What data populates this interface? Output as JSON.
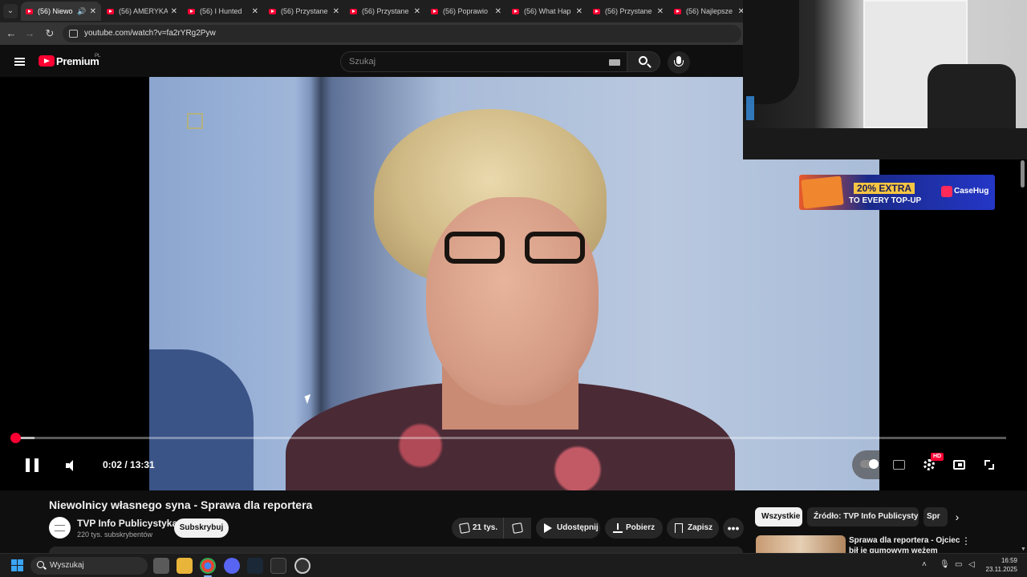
{
  "browser": {
    "tabs": [
      {
        "label": "(56) Niewo",
        "active": true,
        "audio": true
      },
      {
        "label": "(56) AMERYKA",
        "active": false
      },
      {
        "label": "(56) I Hunted",
        "active": false
      },
      {
        "label": "(56) Przystane",
        "active": false
      },
      {
        "label": "(56) Przystane",
        "active": false
      },
      {
        "label": "(56) Poprawio",
        "active": false
      },
      {
        "label": "(56) What Hap",
        "active": false
      },
      {
        "label": "(56) Przystane",
        "active": false
      },
      {
        "label": "(56) Najlepsze",
        "active": false
      }
    ],
    "url": "youtube.com/watch?v=fa2rYRg2Pyw"
  },
  "youtube": {
    "logo_text": "Premium",
    "region": "PL",
    "search_placeholder": "Szukaj"
  },
  "player": {
    "current_time": "0:02",
    "duration": "13:31",
    "timecode": "0:02 / 13:31",
    "progress_fraction": 0.0025,
    "buffered_fraction": 0.02,
    "hd_badge": "HD"
  },
  "video": {
    "title": "Niewolnicy własnego syna - Sprawa dla reportera",
    "channel_name": "TVP Info Publicystyka",
    "subscribers": "220 tys. subskrybentów",
    "subscribe_label": "Subskrybuj",
    "likes": "21 tys.",
    "share_label": "Udostępnij",
    "download_label": "Pobierz",
    "save_label": "Zapisz",
    "more_label": "•••"
  },
  "sidebar": {
    "chips": [
      {
        "label": "Wszystkie",
        "active": true
      },
      {
        "label": "Źródło: TVP Info Publicystyka",
        "active": false
      },
      {
        "label": "Spr",
        "active": false
      }
    ],
    "recommended": [
      {
        "title": "Sprawa dla reportera - Ojciec bił je gumowym wężem"
      }
    ]
  },
  "ad": {
    "headline": "20% EXTRA",
    "subline": "TO EVERY TOP-UP",
    "brand": "CaseHug"
  },
  "taskbar": {
    "search_placeholder": "Wyszukaj",
    "time": "16:59",
    "date": "23.11.2025"
  },
  "colors": {
    "youtube_red": "#ff0033",
    "background": "#0f0f0f",
    "chip_bg": "#272727"
  }
}
